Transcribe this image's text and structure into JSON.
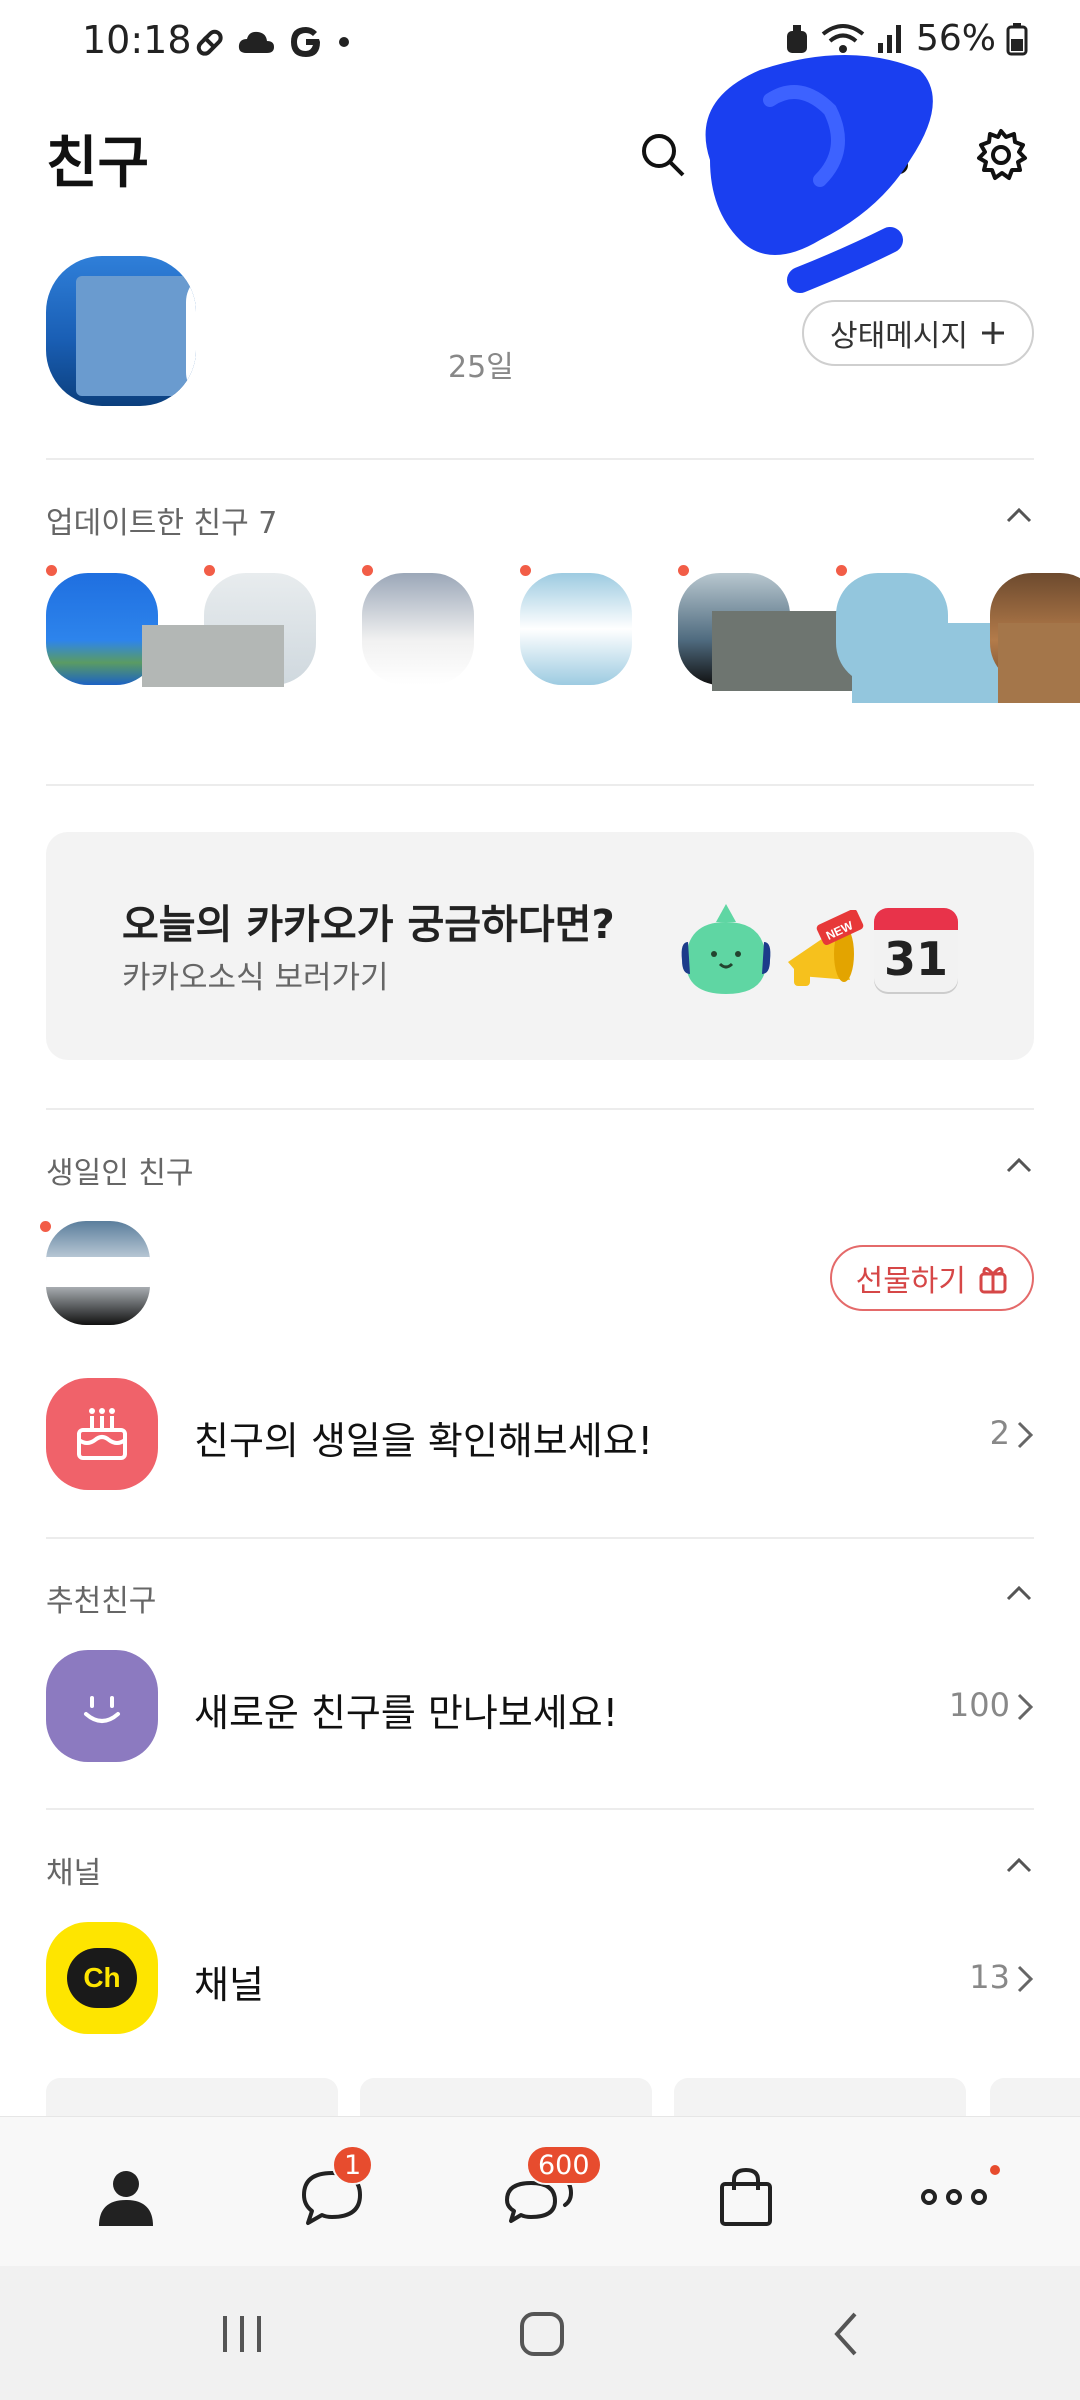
{
  "status_bar": {
    "time": "10:18",
    "battery": "56%"
  },
  "header": {
    "title": "친구"
  },
  "profile": {
    "subtitle": "25일",
    "status_message_label": "상태메시지"
  },
  "updated_friends": {
    "label": "업데이트한 친구 7"
  },
  "news": {
    "title": "오늘의 카카오가 궁금하다면?",
    "subtitle": "카카오소식 보러가기",
    "calendar_day": "31",
    "new_tag": "NEW"
  },
  "birthday": {
    "label": "생일인 친구",
    "gift_label": "선물하기",
    "check_label": "친구의 생일을 확인해보세요!",
    "check_count": "2"
  },
  "recommended": {
    "label": "추천친구",
    "row_label": "새로운 친구를 만나보세요!",
    "count": "100"
  },
  "channel": {
    "label": "채널",
    "row_label": "채널",
    "count": "13",
    "logo_text": "Ch"
  },
  "tabbar": {
    "chats_badge": "1",
    "openchat_badge": "600"
  },
  "colors": {
    "accent_red": "#e74c2e",
    "kakao_yellow": "#fee500",
    "birthday_red": "#f0626a",
    "recommend_purple": "#8c7ac0"
  }
}
